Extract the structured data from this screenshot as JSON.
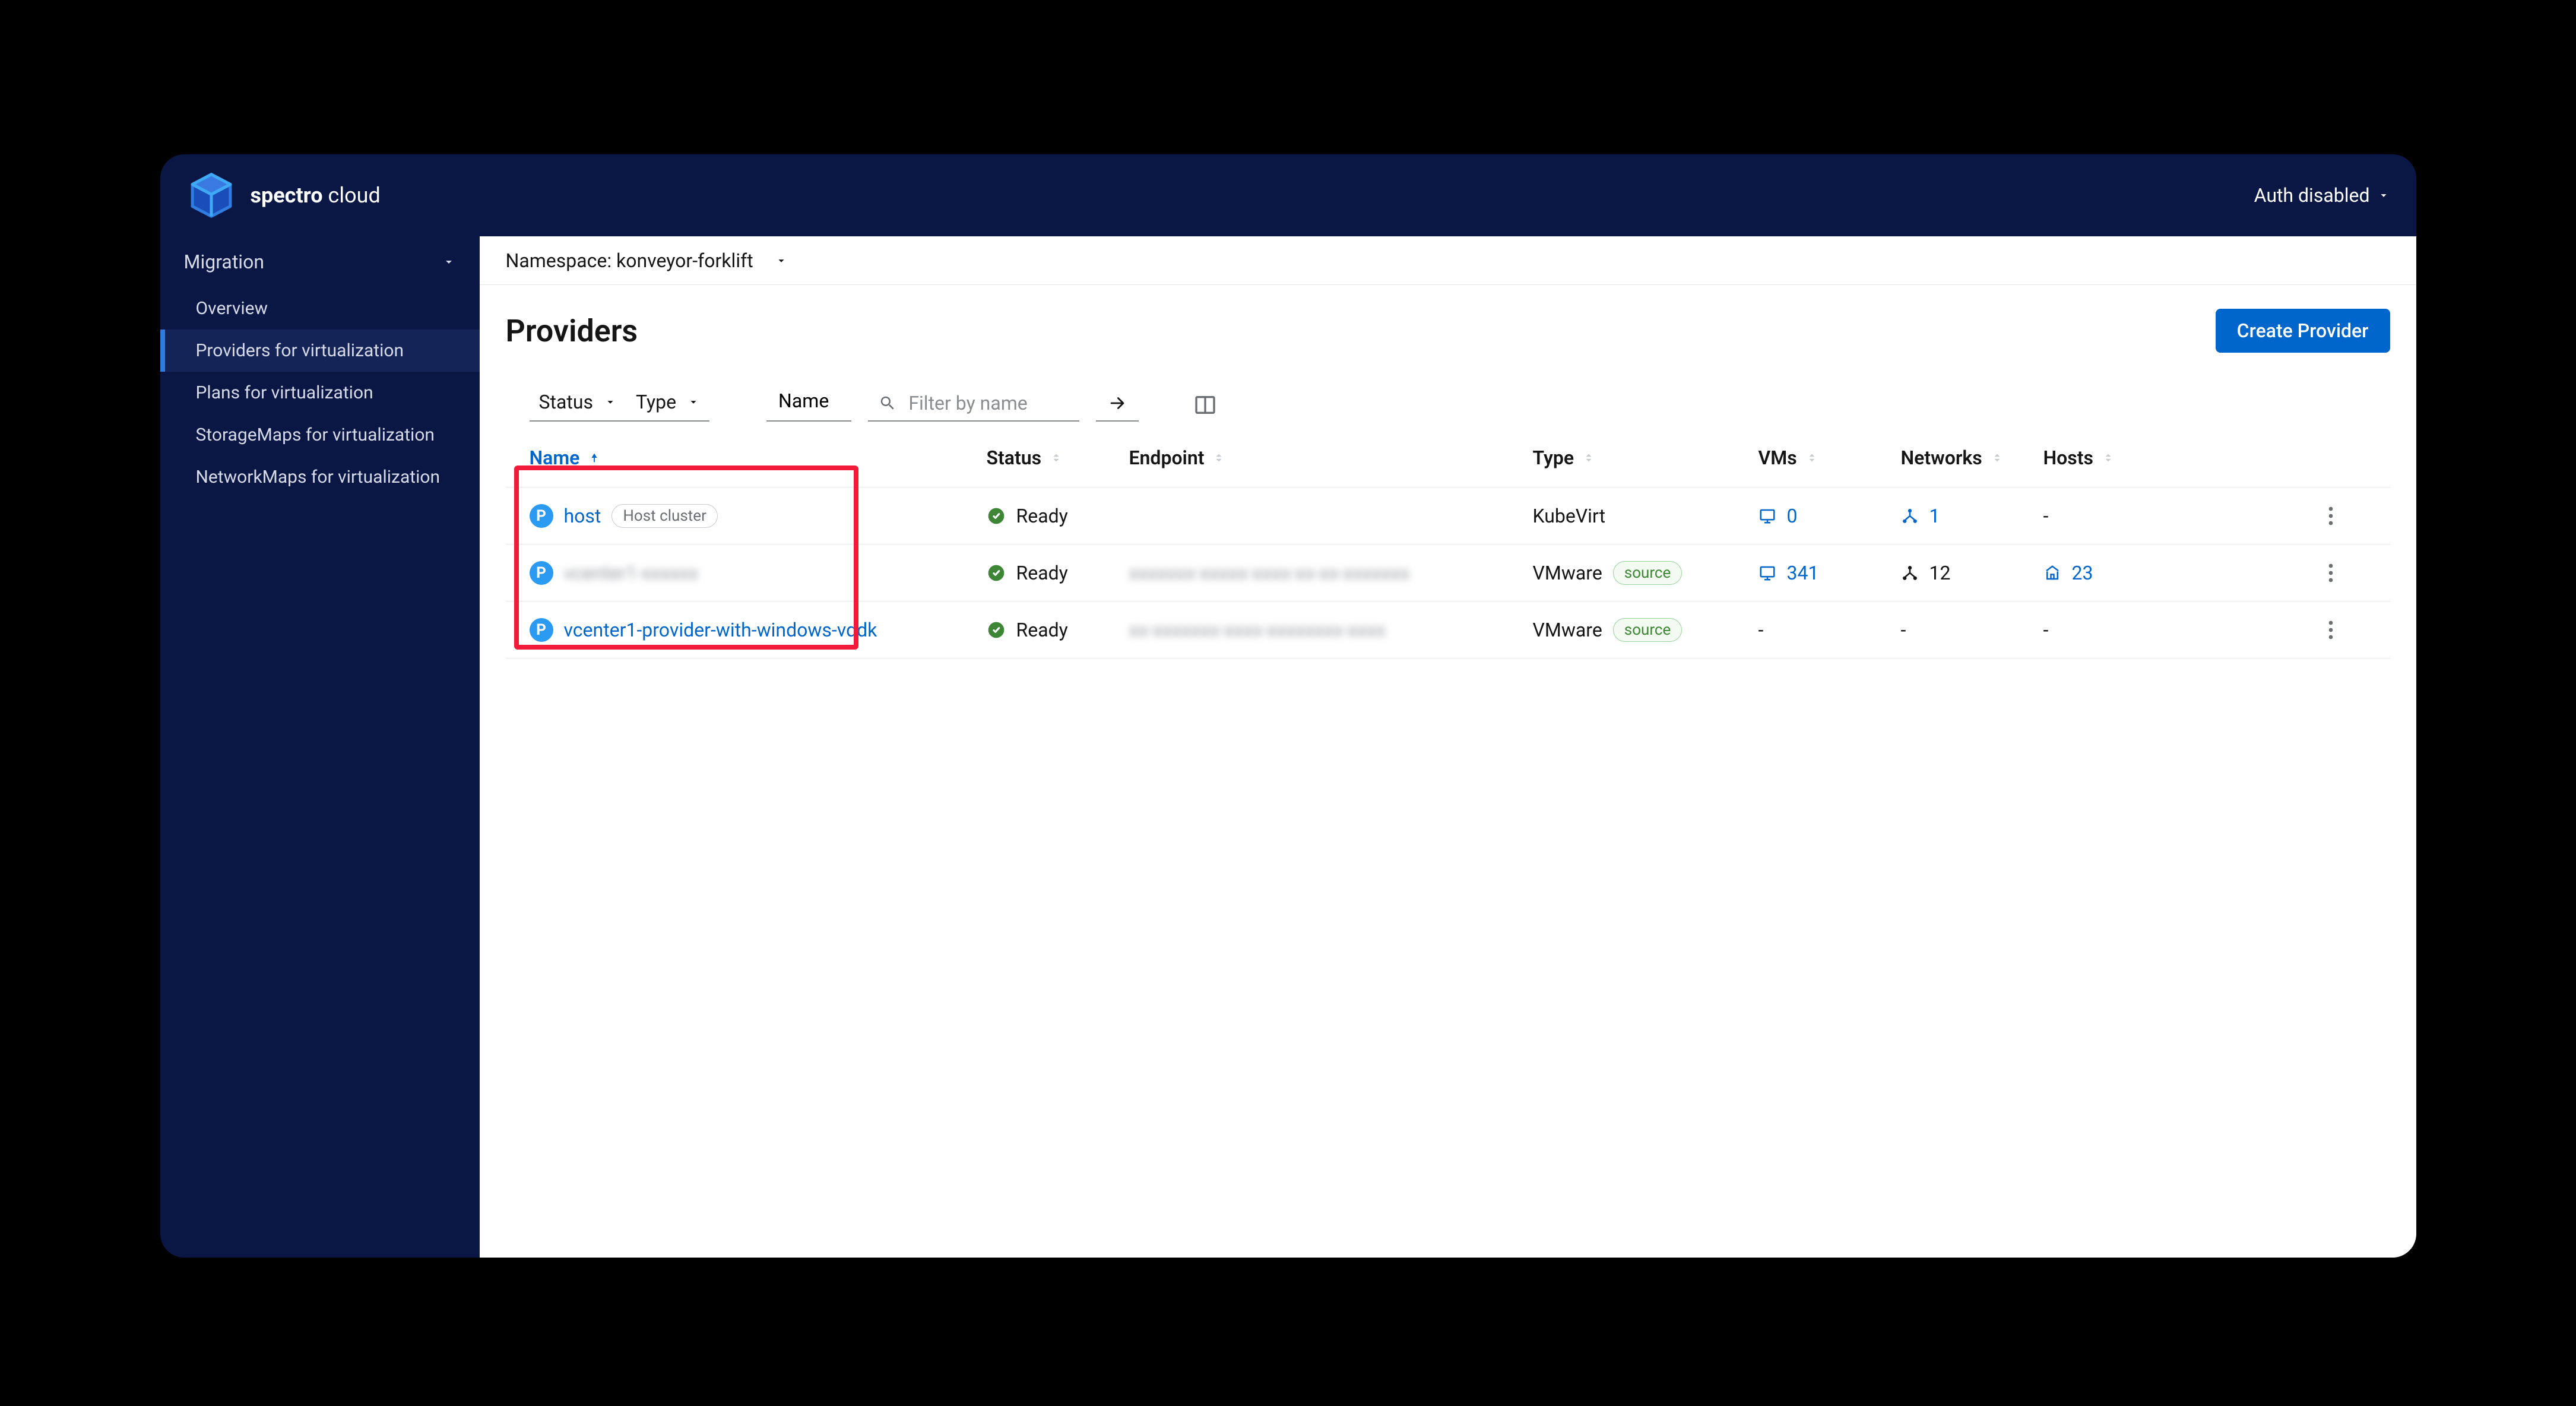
{
  "brand": {
    "name_strong": "spectro",
    "name_light": "cloud"
  },
  "auth": {
    "label": "Auth disabled"
  },
  "sidebar": {
    "section": "Migration",
    "items": [
      {
        "label": "Overview"
      },
      {
        "label": "Providers for virtualization"
      },
      {
        "label": "Plans for virtualization"
      },
      {
        "label": "StorageMaps for virtualization"
      },
      {
        "label": "NetworkMaps for virtualization"
      }
    ]
  },
  "namespace": {
    "prefix": "Namespace:",
    "value": "konveyor-forklift"
  },
  "page": {
    "title": "Providers",
    "create_btn": "Create Provider"
  },
  "filters": {
    "status": "Status",
    "type": "Type",
    "name": "Name",
    "search_placeholder": "Filter by name"
  },
  "columns": {
    "name": "Name",
    "status": "Status",
    "endpoint": "Endpoint",
    "type": "Type",
    "vms": "VMs",
    "networks": "Networks",
    "hosts": "Hosts"
  },
  "rows": [
    {
      "name": "host",
      "name_tag": "Host cluster",
      "status": "Ready",
      "endpoint": "",
      "type": "KubeVirt",
      "type_tag": "",
      "vms": "0",
      "networks": "1",
      "hosts": "-"
    },
    {
      "name": "vcenter1-xxxxxx",
      "name_tag": "",
      "status": "Ready",
      "endpoint": "xxxxxxx-xxxxx-xxxx-xx-xx-xxxxxxx",
      "type": "VMware",
      "type_tag": "source",
      "vms": "341",
      "networks": "12",
      "hosts": "23"
    },
    {
      "name": "vcenter1-provider-with-windows-vddk",
      "name_tag": "",
      "status": "Ready",
      "endpoint": "xx-xxxxxxx-xxxx-xxxxxxxx-xxxx",
      "type": "VMware",
      "type_tag": "source",
      "vms": "-",
      "networks": "-",
      "hosts": "-"
    }
  ]
}
